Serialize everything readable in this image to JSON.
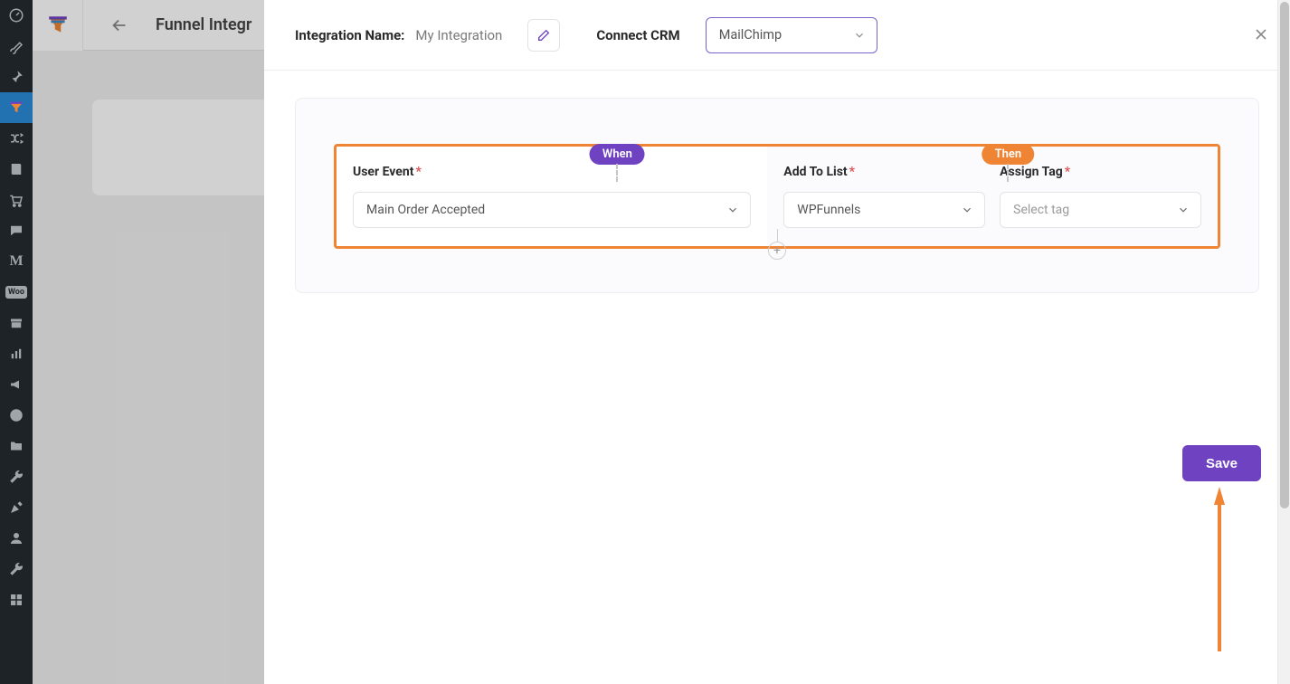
{
  "sidebar": {
    "items": [
      {
        "name": "dashboard-icon"
      },
      {
        "name": "brush-icon"
      },
      {
        "name": "pin-icon"
      },
      {
        "name": "funnel-icon",
        "active": true
      },
      {
        "name": "shuffle-icon"
      },
      {
        "name": "book-icon"
      },
      {
        "name": "gift-icon"
      },
      {
        "name": "chat-icon"
      },
      {
        "name": "m-icon"
      },
      {
        "name": "woo-icon"
      },
      {
        "name": "archive-icon"
      },
      {
        "name": "bars-icon"
      },
      {
        "name": "megaphone-icon"
      },
      {
        "name": "elementor-icon"
      },
      {
        "name": "folder-icon"
      },
      {
        "name": "wrench-icon"
      },
      {
        "name": "nib-icon"
      },
      {
        "name": "user-icon"
      },
      {
        "name": "tools-icon"
      },
      {
        "name": "widgets-icon"
      }
    ]
  },
  "background": {
    "page_title": "Funnel Integr"
  },
  "panel": {
    "integration_name_label": "Integration Name:",
    "integration_name_value": "My Integration",
    "connect_crm_label": "Connect CRM",
    "crm_selected": "MailChimp"
  },
  "rule": {
    "when_label": "When",
    "then_label": "Then",
    "user_event_label": "User Event",
    "user_event_value": "Main Order Accepted",
    "add_to_list_label": "Add To List",
    "add_to_list_value": "WPFunnels",
    "assign_tag_label": "Assign Tag",
    "assign_tag_placeholder": "Select tag"
  },
  "actions": {
    "save_label": "Save"
  }
}
